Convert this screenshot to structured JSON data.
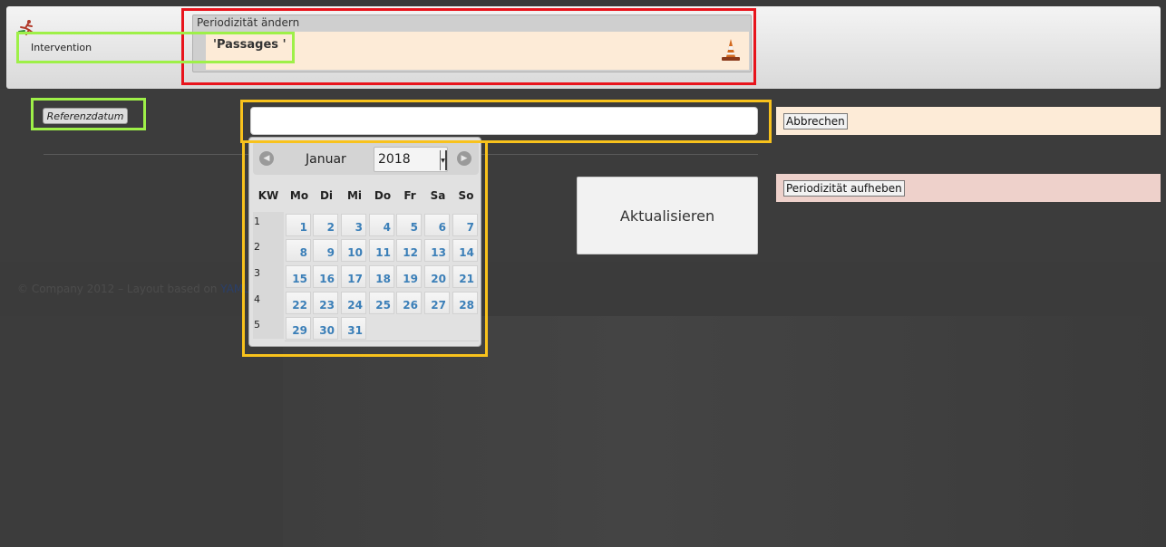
{
  "header": {
    "intervention_label": "Intervention",
    "periodicity_title": "Periodizität ändern",
    "item_name": "'Passages '",
    "cone_icon": "traffic-cone-icon"
  },
  "form": {
    "reference_date_button": "Referenzdatum",
    "date_value": "",
    "cancel_button": "Abbrechen",
    "remove_periodicity_button": "Periodizität aufheben",
    "update_button": "Aktualisieren"
  },
  "datepicker": {
    "month": "Januar",
    "year": "2018",
    "prev_icon": "chevron-left-icon",
    "next_icon": "chevron-right-icon",
    "week_header": "KW",
    "weekdays": [
      "Mo",
      "Di",
      "Mi",
      "Do",
      "Fr",
      "Sa",
      "So"
    ],
    "weeks": [
      {
        "kw": "1",
        "days": [
          "1",
          "2",
          "3",
          "4",
          "5",
          "6",
          "7"
        ]
      },
      {
        "kw": "2",
        "days": [
          "8",
          "9",
          "10",
          "11",
          "12",
          "13",
          "14"
        ]
      },
      {
        "kw": "3",
        "days": [
          "15",
          "16",
          "17",
          "18",
          "19",
          "20",
          "21"
        ]
      },
      {
        "kw": "4",
        "days": [
          "22",
          "23",
          "24",
          "25",
          "26",
          "27",
          "28"
        ]
      },
      {
        "kw": "5",
        "days": [
          "29",
          "30",
          "31"
        ]
      }
    ]
  },
  "footer": {
    "text": "© Company 2012 – Layout based on ",
    "link": "YAML"
  },
  "colors": {
    "highlight_red": "#e8141c",
    "highlight_green": "#9ef048",
    "highlight_yellow": "#f8c21c",
    "day_text": "#3b7fb8",
    "cancel_bg": "#fdebd7",
    "remove_bg": "#eed1cb"
  }
}
